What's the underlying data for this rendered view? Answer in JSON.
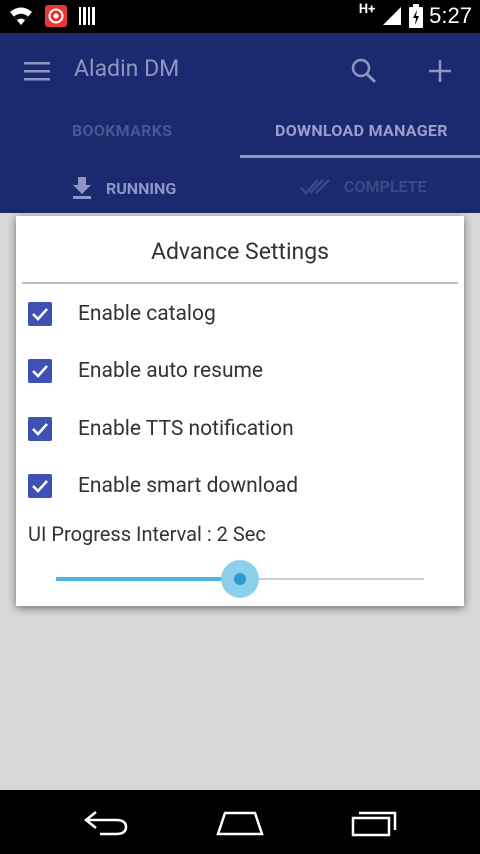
{
  "status_bar": {
    "time": "5:27",
    "network": "H+"
  },
  "toolbar": {
    "title": "Aladin DM"
  },
  "tabs": [
    {
      "label": "BOOKMARKS",
      "active": false
    },
    {
      "label": "DOWNLOAD MANAGER",
      "active": true
    }
  ],
  "subtabs": [
    {
      "label": "RUNNING",
      "active": true
    },
    {
      "label": "COMPLETE",
      "active": false
    }
  ],
  "dialog": {
    "title": "Advance Settings",
    "options": [
      {
        "label": "Enable catalog",
        "checked": true
      },
      {
        "label": "Enable auto resume",
        "checked": true
      },
      {
        "label": "Enable TTS notification",
        "checked": true
      },
      {
        "label": "Enable smart download",
        "checked": true
      }
    ],
    "interval_label": "UI Progress Interval : 2 Sec",
    "slider_value_fraction": 0.5
  },
  "colors": {
    "primary": "#1b2a6e",
    "accent": "#3f51b5",
    "slider": "#4fb4e0"
  }
}
